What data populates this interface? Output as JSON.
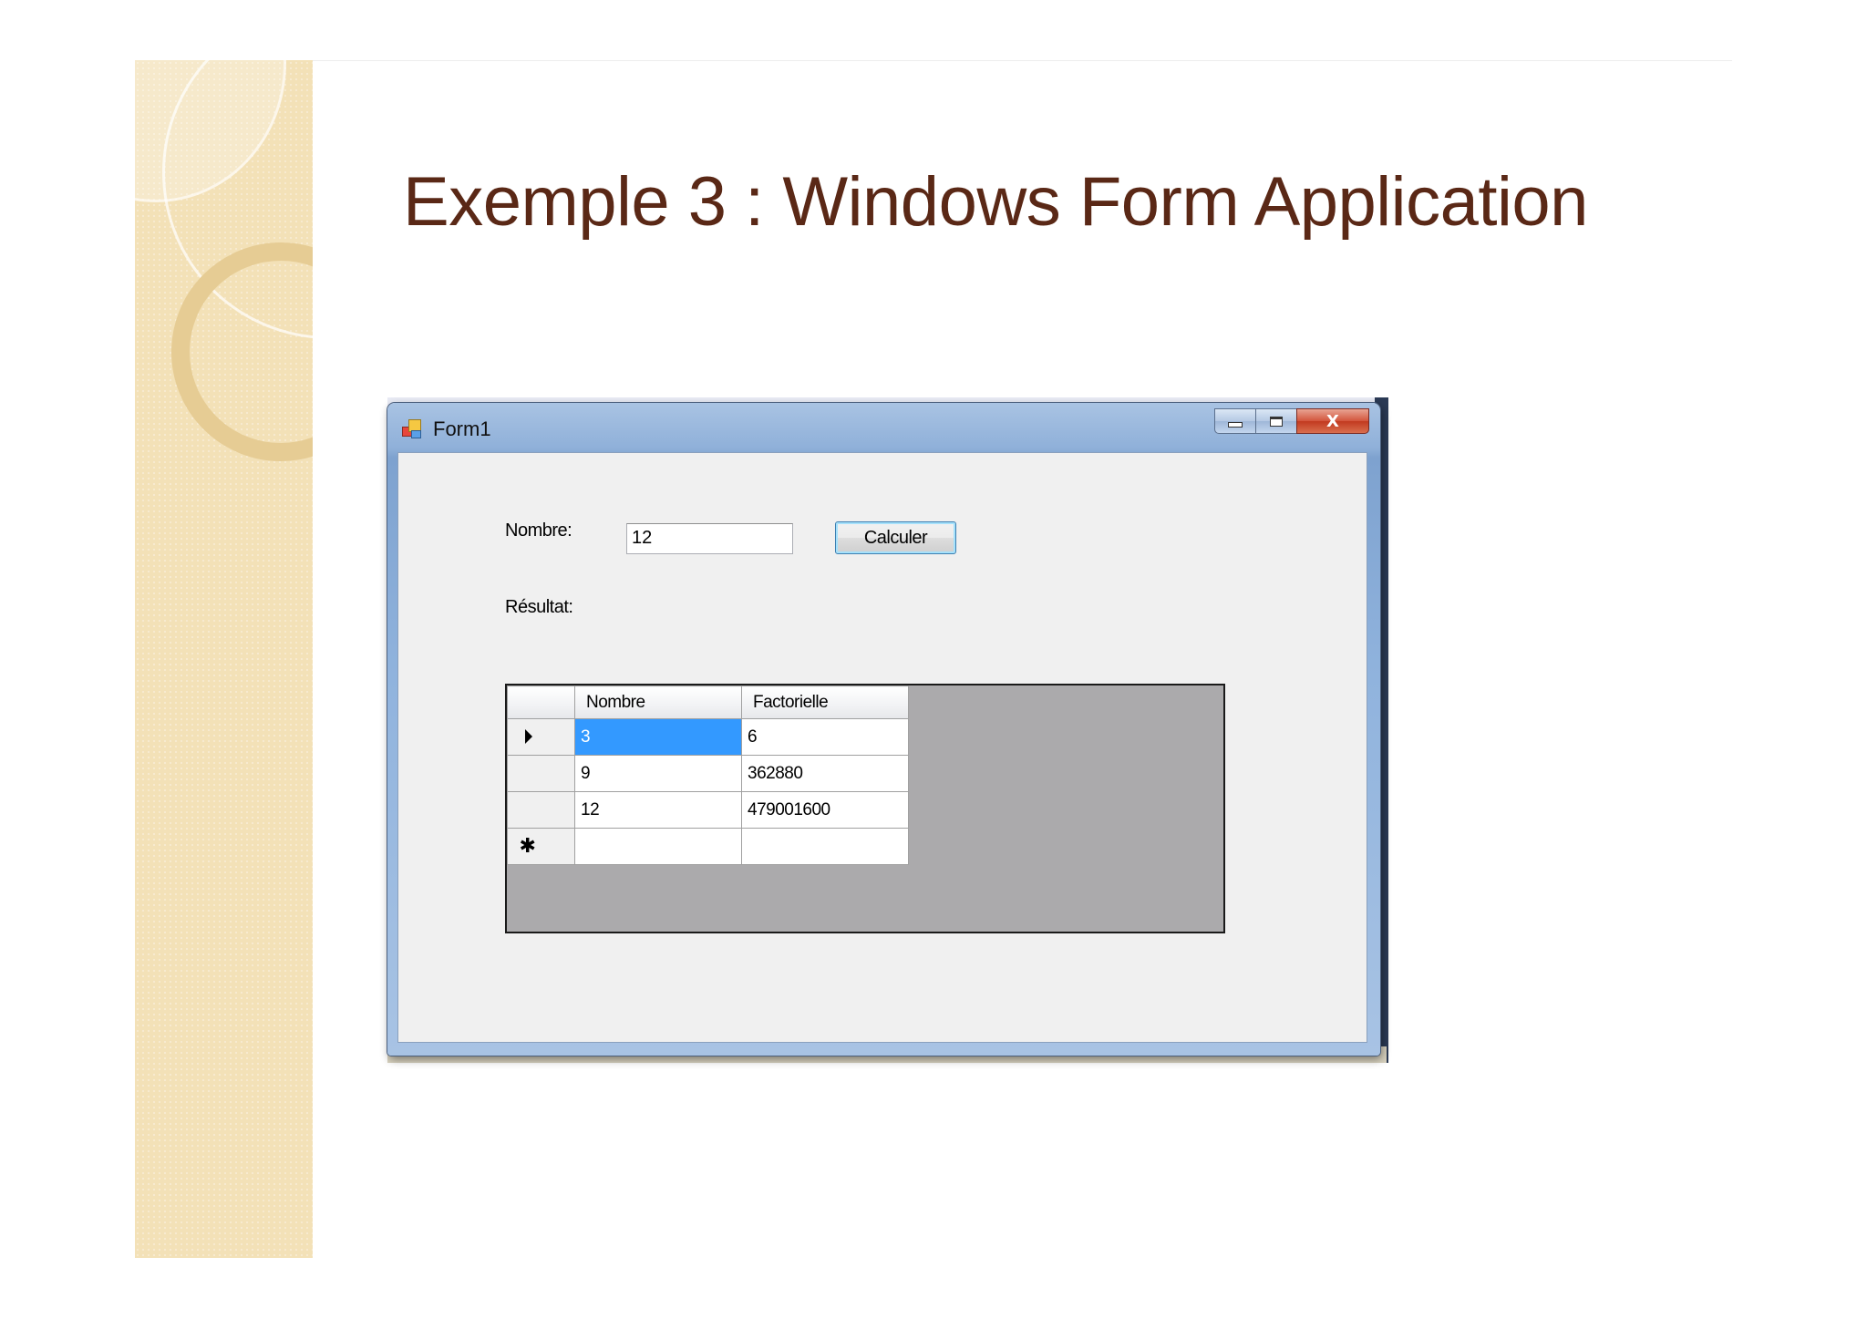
{
  "slide": {
    "title": "Exemple 3 : Windows Form Application"
  },
  "window": {
    "title": "Form1",
    "close_glyph": "X",
    "min_icon": "minimize-icon",
    "max_icon": "maximize-icon",
    "app_icon": "form-app-icon"
  },
  "form": {
    "nombre_label": "Nombre:",
    "nombre_value": "12",
    "calculer_label": "Calculer",
    "resultat_label": "Résultat:"
  },
  "grid": {
    "columns": [
      "Nombre",
      "Factorielle"
    ],
    "rows": [
      {
        "nombre": "3",
        "factorielle": "6",
        "current": true
      },
      {
        "nombre": "9",
        "factorielle": "362880"
      },
      {
        "nombre": "12",
        "factorielle": "479001600"
      }
    ],
    "new_row_glyph": "✱",
    "current_row_icon": "current-row-arrow-icon"
  }
}
